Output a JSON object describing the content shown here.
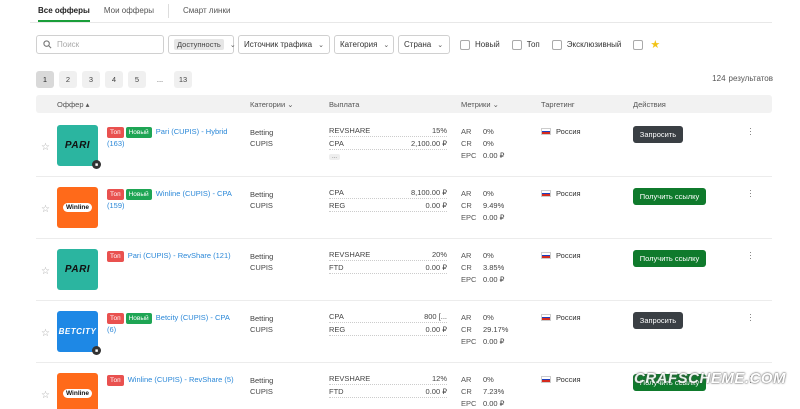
{
  "tabs": [
    {
      "label": "Все офферы",
      "active": true
    },
    {
      "label": "Мои офферы",
      "active": false
    },
    {
      "label": "Смарт линки",
      "active": false
    }
  ],
  "filters": {
    "search_placeholder": "Поиск",
    "availability_chip": "Доступность",
    "traffic_source": "Источник трафика",
    "category": "Категория",
    "country": "Страна",
    "checkboxes": [
      "Новый",
      "Топ",
      "Эксклюзивный"
    ]
  },
  "pagination": {
    "pages": [
      "1",
      "2",
      "3",
      "4",
      "5",
      "...",
      "13"
    ],
    "current": "1",
    "results_count": "124",
    "results_label": "результатов"
  },
  "table_header": {
    "offer": "Оффер ▴",
    "categories": "Категории ⌄",
    "payout": "Выплата",
    "metrics": "Метрики ⌄",
    "targeting": "Таргетинг",
    "actions": "Действия"
  },
  "rows": [
    {
      "logo": "PARI",
      "locked": true,
      "badges": [
        "Топ",
        "Новый"
      ],
      "name": "Pari (CUPIS) - Hybrid (163)",
      "cat1": "Betting",
      "cat2": "CUPIS",
      "pay1k": "REVSHARE",
      "pay1v": "15%",
      "pay2k": "CPA",
      "pay2v": "2,100.00 ₽",
      "more": "...",
      "ar": "0%",
      "cr": "0%",
      "epc": "0.00 ₽",
      "country": "Россия",
      "action": "Запросить"
    },
    {
      "logo": "Winline",
      "locked": false,
      "badges": [
        "Топ",
        "Новый"
      ],
      "name": "Winline (CUPIS) - CPA (159)",
      "cat1": "Betting",
      "cat2": "CUPIS",
      "pay1k": "CPA",
      "pay1v": "8,100.00 ₽",
      "pay2k": "REG",
      "pay2v": "0.00 ₽",
      "ar": "0%",
      "cr": "9.49%",
      "epc": "0.00 ₽",
      "country": "Россия",
      "action": "Получить ссылку"
    },
    {
      "logo": "PARI",
      "locked": false,
      "badges": [
        "Топ"
      ],
      "name": "Pari (CUPIS) - RevShare (121)",
      "cat1": "Betting",
      "cat2": "CUPIS",
      "pay1k": "REVSHARE",
      "pay1v": "20%",
      "pay2k": "FTD",
      "pay2v": "0.00 ₽",
      "ar": "0%",
      "cr": "3.85%",
      "epc": "0.00 ₽",
      "country": "Россия",
      "action": "Получить ссылку"
    },
    {
      "logo": "BETCITY",
      "locked": true,
      "badges": [
        "Топ",
        "Новый"
      ],
      "name": "Betcity (CUPIS) - CPA (6)",
      "cat1": "Betting",
      "cat2": "CUPIS",
      "pay1k": "CPA",
      "pay1v": "800 [...",
      "pay2k": "REG",
      "pay2v": "0.00 ₽",
      "ar": "0%",
      "cr": "29.17%",
      "epc": "0.00 ₽",
      "country": "Россия",
      "action": "Запросить"
    },
    {
      "logo": "Winline",
      "locked": false,
      "badges": [
        "Топ"
      ],
      "name": "Winline (CUPIS) - RevShare (5)",
      "cat1": "Betting",
      "cat2": "CUPIS",
      "pay1k": "REVSHARE",
      "pay1v": "12%",
      "pay2k": "FTD",
      "pay2v": "0.00 ₽",
      "ar": "0%",
      "cr": "7.23%",
      "epc": "0.00 ₽",
      "country": "Россия",
      "action": "Получить ссылку"
    }
  ],
  "metric_keys": {
    "ar": "AR",
    "cr": "CR",
    "epc": "EPC"
  },
  "watermark": "CRAFSCHEME.COM",
  "colors": {
    "accent_green": "#0f7a2c",
    "badge_top": "#e9514f",
    "badge_new": "#1ea554",
    "link_blue": "#2b88d8"
  }
}
